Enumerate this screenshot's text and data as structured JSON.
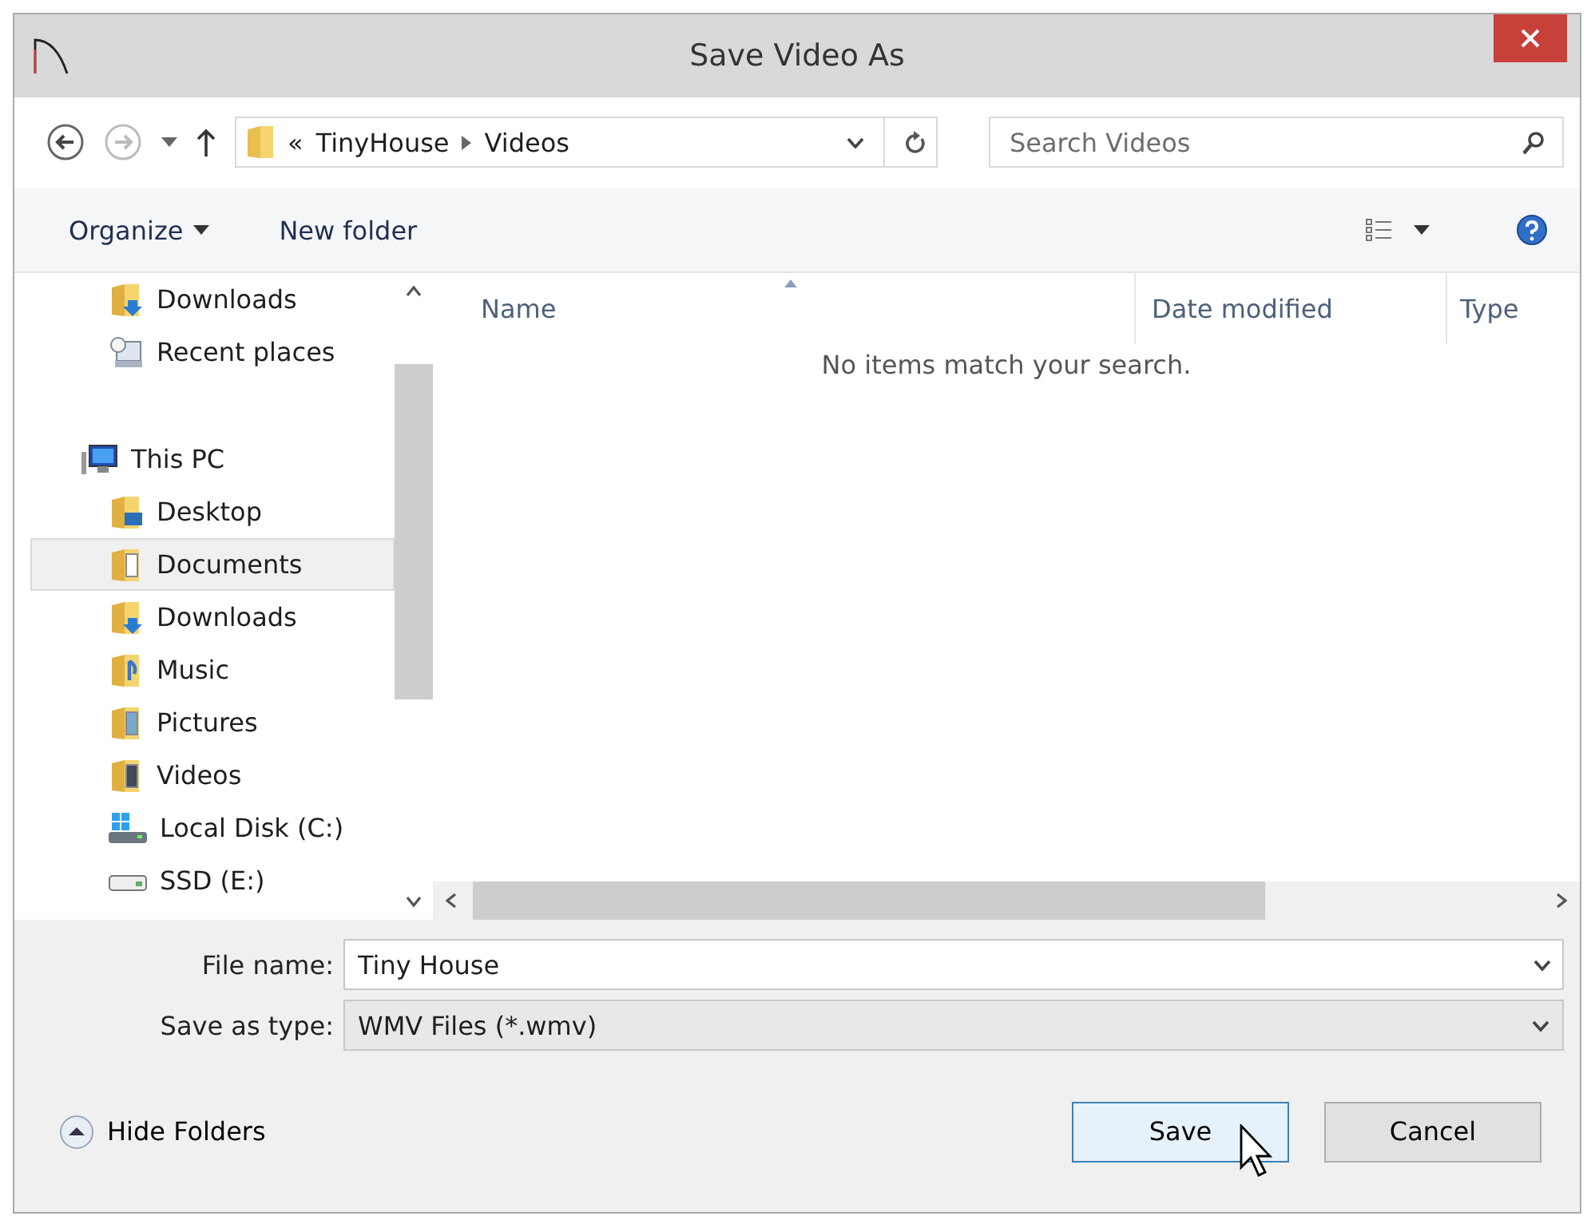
{
  "window": {
    "title": "Save Video As"
  },
  "address": {
    "overflow": "«",
    "crumbs": [
      "TinyHouse",
      "Videos"
    ]
  },
  "search": {
    "placeholder": "Search Videos"
  },
  "toolbar": {
    "organize": "Organize",
    "new_folder": "New folder"
  },
  "nav": {
    "top_items": [
      {
        "label": "Downloads",
        "kind": "downloads",
        "selected": false
      },
      {
        "label": "Recent places",
        "kind": "recent",
        "selected": false
      }
    ],
    "groups": [
      {
        "label": "This PC",
        "kind": "computer",
        "children": [
          {
            "label": "Desktop",
            "kind": "desktop",
            "selected": false
          },
          {
            "label": "Documents",
            "kind": "documents",
            "selected": true
          },
          {
            "label": "Downloads",
            "kind": "downloads",
            "selected": false
          },
          {
            "label": "Music",
            "kind": "music",
            "selected": false
          },
          {
            "label": "Pictures",
            "kind": "pictures",
            "selected": false
          },
          {
            "label": "Videos",
            "kind": "videos",
            "selected": false
          },
          {
            "label": "Local Disk (C:)",
            "kind": "system-disk",
            "selected": false
          },
          {
            "label": "SSD (E:)",
            "kind": "drive",
            "selected": false
          }
        ]
      }
    ]
  },
  "table": {
    "columns": [
      "Name",
      "Date modified",
      "Type"
    ],
    "empty_message": "No items match your search."
  },
  "form": {
    "file_name_label": "File name:",
    "file_name": "Tiny House",
    "type_label": "Save as type:",
    "type_value": "WMV Files (*.wmv)"
  },
  "footer": {
    "hide_folders": "Hide Folders",
    "save": "Save",
    "cancel": "Cancel"
  }
}
